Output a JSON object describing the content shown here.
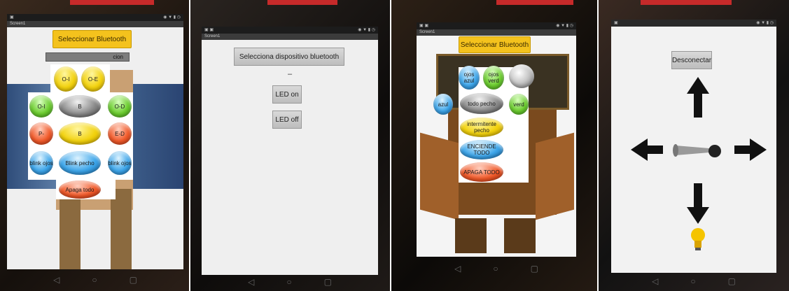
{
  "panels": [
    {
      "select_button": "Seleccionar Bluetooth",
      "sub_label_fragment": "cion",
      "buttons": [
        "O-I",
        "O-E",
        "O-I",
        "B",
        "O-D",
        "P-",
        "B",
        "E-D",
        "blink ojos",
        "Blink pecho",
        "blink ojos",
        "Apaga todo"
      ]
    },
    {
      "select_button": "Selecciona dispositivo bluetooth",
      "dash": "–",
      "led_on": "LED on",
      "led_off": "LED off"
    },
    {
      "select_button": "Seleccionar Bluetooth",
      "ojos_azul": "ojos azul",
      "ojos_verd": "ojos verd",
      "todo_pecho": "todo pecho",
      "azul_side": "azul",
      "green_side": "verd",
      "intermitente": "intermitente pecho",
      "enciende": "ENCIENDE TODO",
      "apaga": "APAGA TODO"
    },
    {
      "disconnect": "Desconectar"
    }
  ],
  "nav_icons": [
    "back-icon",
    "home-icon",
    "recents-icon"
  ],
  "colors": {
    "accent_red": "#c62a2a",
    "select_yellow": "#f4c21d"
  }
}
